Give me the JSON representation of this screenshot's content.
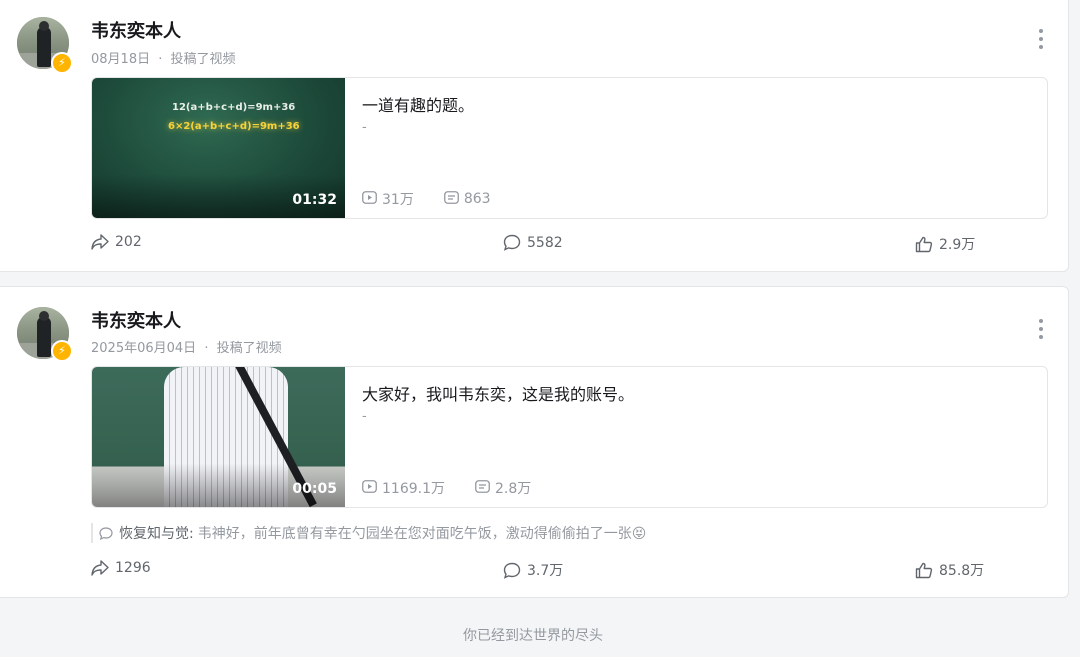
{
  "posts": [
    {
      "author": "韦东奕本人",
      "date": "08月18日",
      "action": "投稿了视频",
      "video": {
        "title": "一道有趣的题。",
        "desc": "-",
        "duration": "01:32",
        "plays": "31万",
        "danmaku": "863",
        "thumb_text": [
          "12(a+b+c+d)=9m+36",
          "6×2(a+b+c+d)=9m+36"
        ]
      },
      "stats": {
        "share": "202",
        "comment": "5582",
        "like": "2.9万"
      }
    },
    {
      "author": "韦东奕本人",
      "date": "2025年06月04日",
      "action": "投稿了视频",
      "video": {
        "title": "大家好，我叫韦东奕，这是我的账号。",
        "desc": "-",
        "duration": "00:05",
        "plays": "1169.1万",
        "danmaku": "2.8万"
      },
      "top_comment": {
        "user": "恢复知与觉:",
        "text": "韦神好，前年底曾有幸在勺园坐在您对面吃午饭，激动得偷偷拍了一张😝"
      },
      "stats": {
        "share": "1296",
        "comment": "3.7万",
        "like": "85.8万"
      }
    }
  ],
  "end_text": "你已经到达世界的尽头",
  "meta_separator": "·",
  "colors": {
    "accent_badge": "#ffb400",
    "muted": "#9499a0",
    "text": "#18191c"
  }
}
